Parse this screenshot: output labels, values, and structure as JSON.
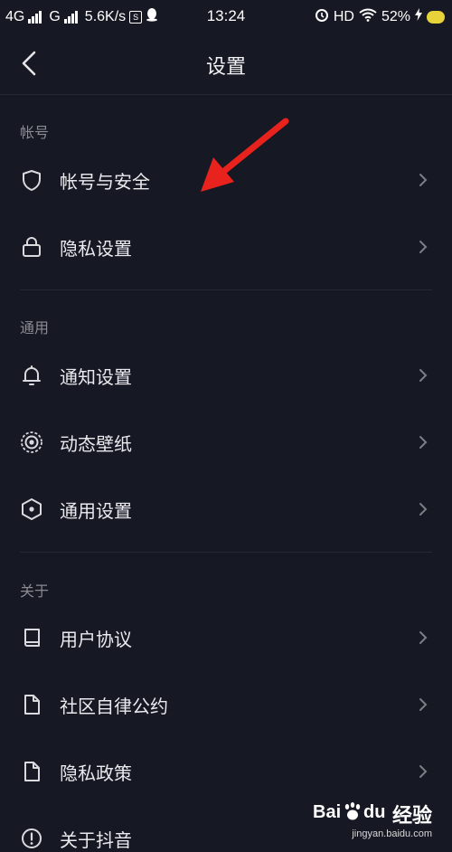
{
  "status_bar": {
    "network1": "4G",
    "network2": "G",
    "speed": "5.6K/s",
    "time": "13:24",
    "hd": "HD",
    "battery": "52%"
  },
  "header": {
    "title": "设置"
  },
  "sections": [
    {
      "header": "帐号",
      "items": [
        {
          "label": "帐号与安全",
          "icon": "shield-icon"
        },
        {
          "label": "隐私设置",
          "icon": "lock-icon"
        }
      ]
    },
    {
      "header": "通用",
      "items": [
        {
          "label": "通知设置",
          "icon": "bell-icon"
        },
        {
          "label": "动态壁纸",
          "icon": "wallpaper-icon"
        },
        {
          "label": "通用设置",
          "icon": "hexagon-settings-icon"
        }
      ]
    },
    {
      "header": "关于",
      "items": [
        {
          "label": "用户协议",
          "icon": "book-icon"
        },
        {
          "label": "社区自律公约",
          "icon": "document-icon"
        },
        {
          "label": "隐私政策",
          "icon": "document-icon"
        },
        {
          "label": "关于抖音",
          "icon": "info-icon"
        }
      ]
    }
  ],
  "colors": {
    "background": "#161823",
    "annotation_arrow": "#e8231d"
  },
  "watermark": {
    "brand_cn": "经验",
    "url": "jingyan.baidu.com"
  }
}
